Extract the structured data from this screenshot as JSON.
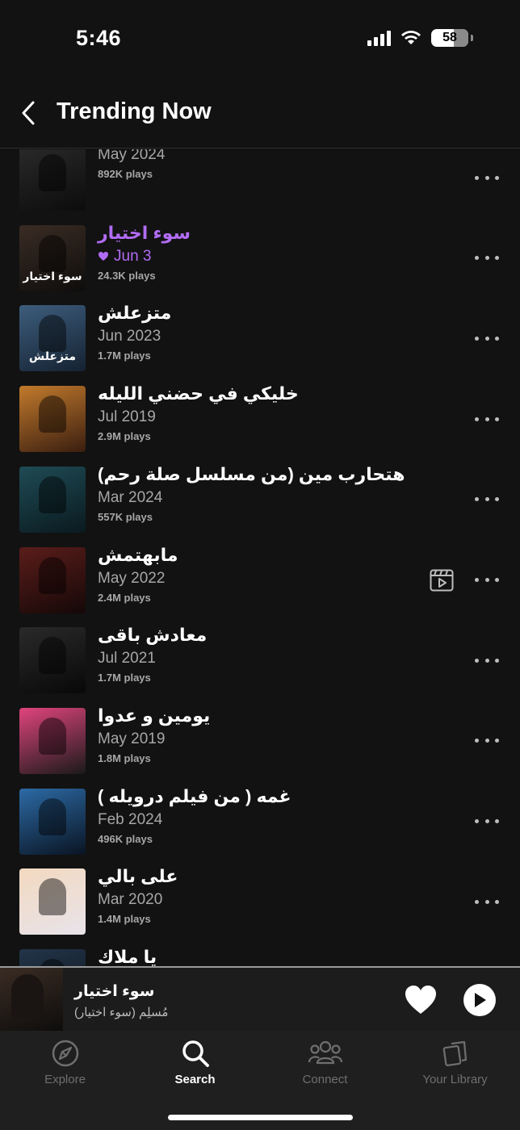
{
  "status": {
    "time": "5:46",
    "battery": "58"
  },
  "header": {
    "title": "Trending Now",
    "back_icon": "chevron-left-icon"
  },
  "tracks": [
    {
      "title": "",
      "date": "May 2024",
      "plays": "892K plays",
      "thumb_colors": [
        "#2a2a2a",
        "#0c0c0c"
      ],
      "thumb_text": ""
    },
    {
      "title": "سوء اختيار",
      "date": "Jun 3",
      "plays": "24.3K plays",
      "liked": true,
      "thumb_colors": [
        "#3a2c24",
        "#0e0d0c"
      ],
      "thumb_text": "سوء اختيار"
    },
    {
      "title": "متزعلش",
      "date": "Jun 2023",
      "plays": "1.7M plays",
      "thumb_colors": [
        "#3d5d7c",
        "#152232"
      ],
      "thumb_text": "متزعلش"
    },
    {
      "title": "خليكي في حضني الليله",
      "date": "Jul 2019",
      "plays": "2.9M plays",
      "thumb_colors": [
        "#c27a2c",
        "#3a1e10"
      ],
      "thumb_text": ""
    },
    {
      "title": "هتحارب مين (من مسلسل صلة رحم)",
      "date": "Mar 2024",
      "plays": "557K plays",
      "thumb_colors": [
        "#1f4b55",
        "#0a1a1f"
      ],
      "thumb_text": ""
    },
    {
      "title": "مابهتمش",
      "date": "May 2022",
      "plays": "2.4M plays",
      "has_video": true,
      "thumb_colors": [
        "#5a1d1a",
        "#150808"
      ],
      "thumb_text": ""
    },
    {
      "title": "معادش باقى",
      "date": "Jul 2021",
      "plays": "1.7M plays",
      "thumb_colors": [
        "#2a2a2a",
        "#080808"
      ],
      "thumb_text": ""
    },
    {
      "title": "يومين و عدوا",
      "date": "May 2019",
      "plays": "1.8M plays",
      "thumb_colors": [
        "#e0447c",
        "#1a1a1a"
      ],
      "thumb_text": ""
    },
    {
      "title": "غمه ( من فيلم درويله )",
      "date": "Feb 2024",
      "plays": "496K plays",
      "thumb_colors": [
        "#2c6aa5",
        "#0a1422"
      ],
      "thumb_text": ""
    },
    {
      "title": "على بالي",
      "date": "Mar 2020",
      "plays": "1.4M plays",
      "thumb_colors": [
        "#f3d9c0",
        "#e8e3ea"
      ],
      "thumb_text": ""
    },
    {
      "title": "يا ملاك",
      "date": "",
      "plays": "",
      "thumb_colors": [
        "#23354a",
        "#0c131b"
      ],
      "thumb_text": ""
    }
  ],
  "mini_player": {
    "title": "سوء اختيار",
    "artist": "مُسلِم  (سوء اختيار)",
    "like_icon": "heart-icon",
    "play_icon": "play-icon"
  },
  "tabs": [
    {
      "label": "Explore",
      "icon": "compass-icon",
      "active": false
    },
    {
      "label": "Search",
      "icon": "search-icon",
      "active": true
    },
    {
      "label": "Connect",
      "icon": "people-icon",
      "active": false
    },
    {
      "label": "Your Library",
      "icon": "library-icon",
      "active": false
    }
  ],
  "colors": {
    "accent": "#b16cf4",
    "background": "#121212"
  }
}
